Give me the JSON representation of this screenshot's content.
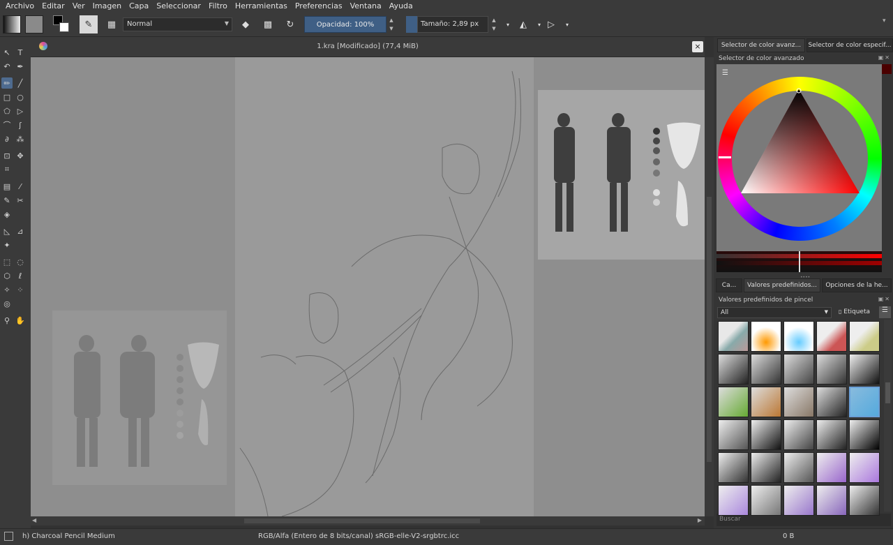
{
  "menu": [
    "Archivo",
    "Editar",
    "Ver",
    "Imagen",
    "Capa",
    "Seleccionar",
    "Filtro",
    "Herramientas",
    "Preferencias",
    "Ventana",
    "Ayuda"
  ],
  "toolbar": {
    "blend_mode": "Normal",
    "opacity": "Opacidad:  100%",
    "size": "Tamaño:  2,89 px"
  },
  "document": {
    "title": "1.kra [Modificado]  (77,4 MiB)",
    "close": "×"
  },
  "docker": {
    "tabs": [
      "Selector de color avanz...",
      "Selector de color especif..."
    ],
    "color_panel_title": "Selector de color avanzado",
    "lower_tabs": [
      "Ca...",
      "Valores predefinidos...",
      "Opciones de la he..."
    ],
    "presets_title": "Valores predefinidos de pincel",
    "filter_value": "All",
    "tag_label": "Etiqueta",
    "search_placeholder": "Buscar"
  },
  "status": {
    "brush": "h) Charcoal Pencil Medium",
    "color_space": "RGB/Alfa (Entero de 8 bits/canal)  sRGB-elle-V2-srgbtrc.icc",
    "memory": "0 B"
  },
  "colors": {
    "accent": "#4e6b8f",
    "slider": "#3f5f85",
    "panel": "#3a3a3a",
    "canvas": "#8e8e8e"
  }
}
